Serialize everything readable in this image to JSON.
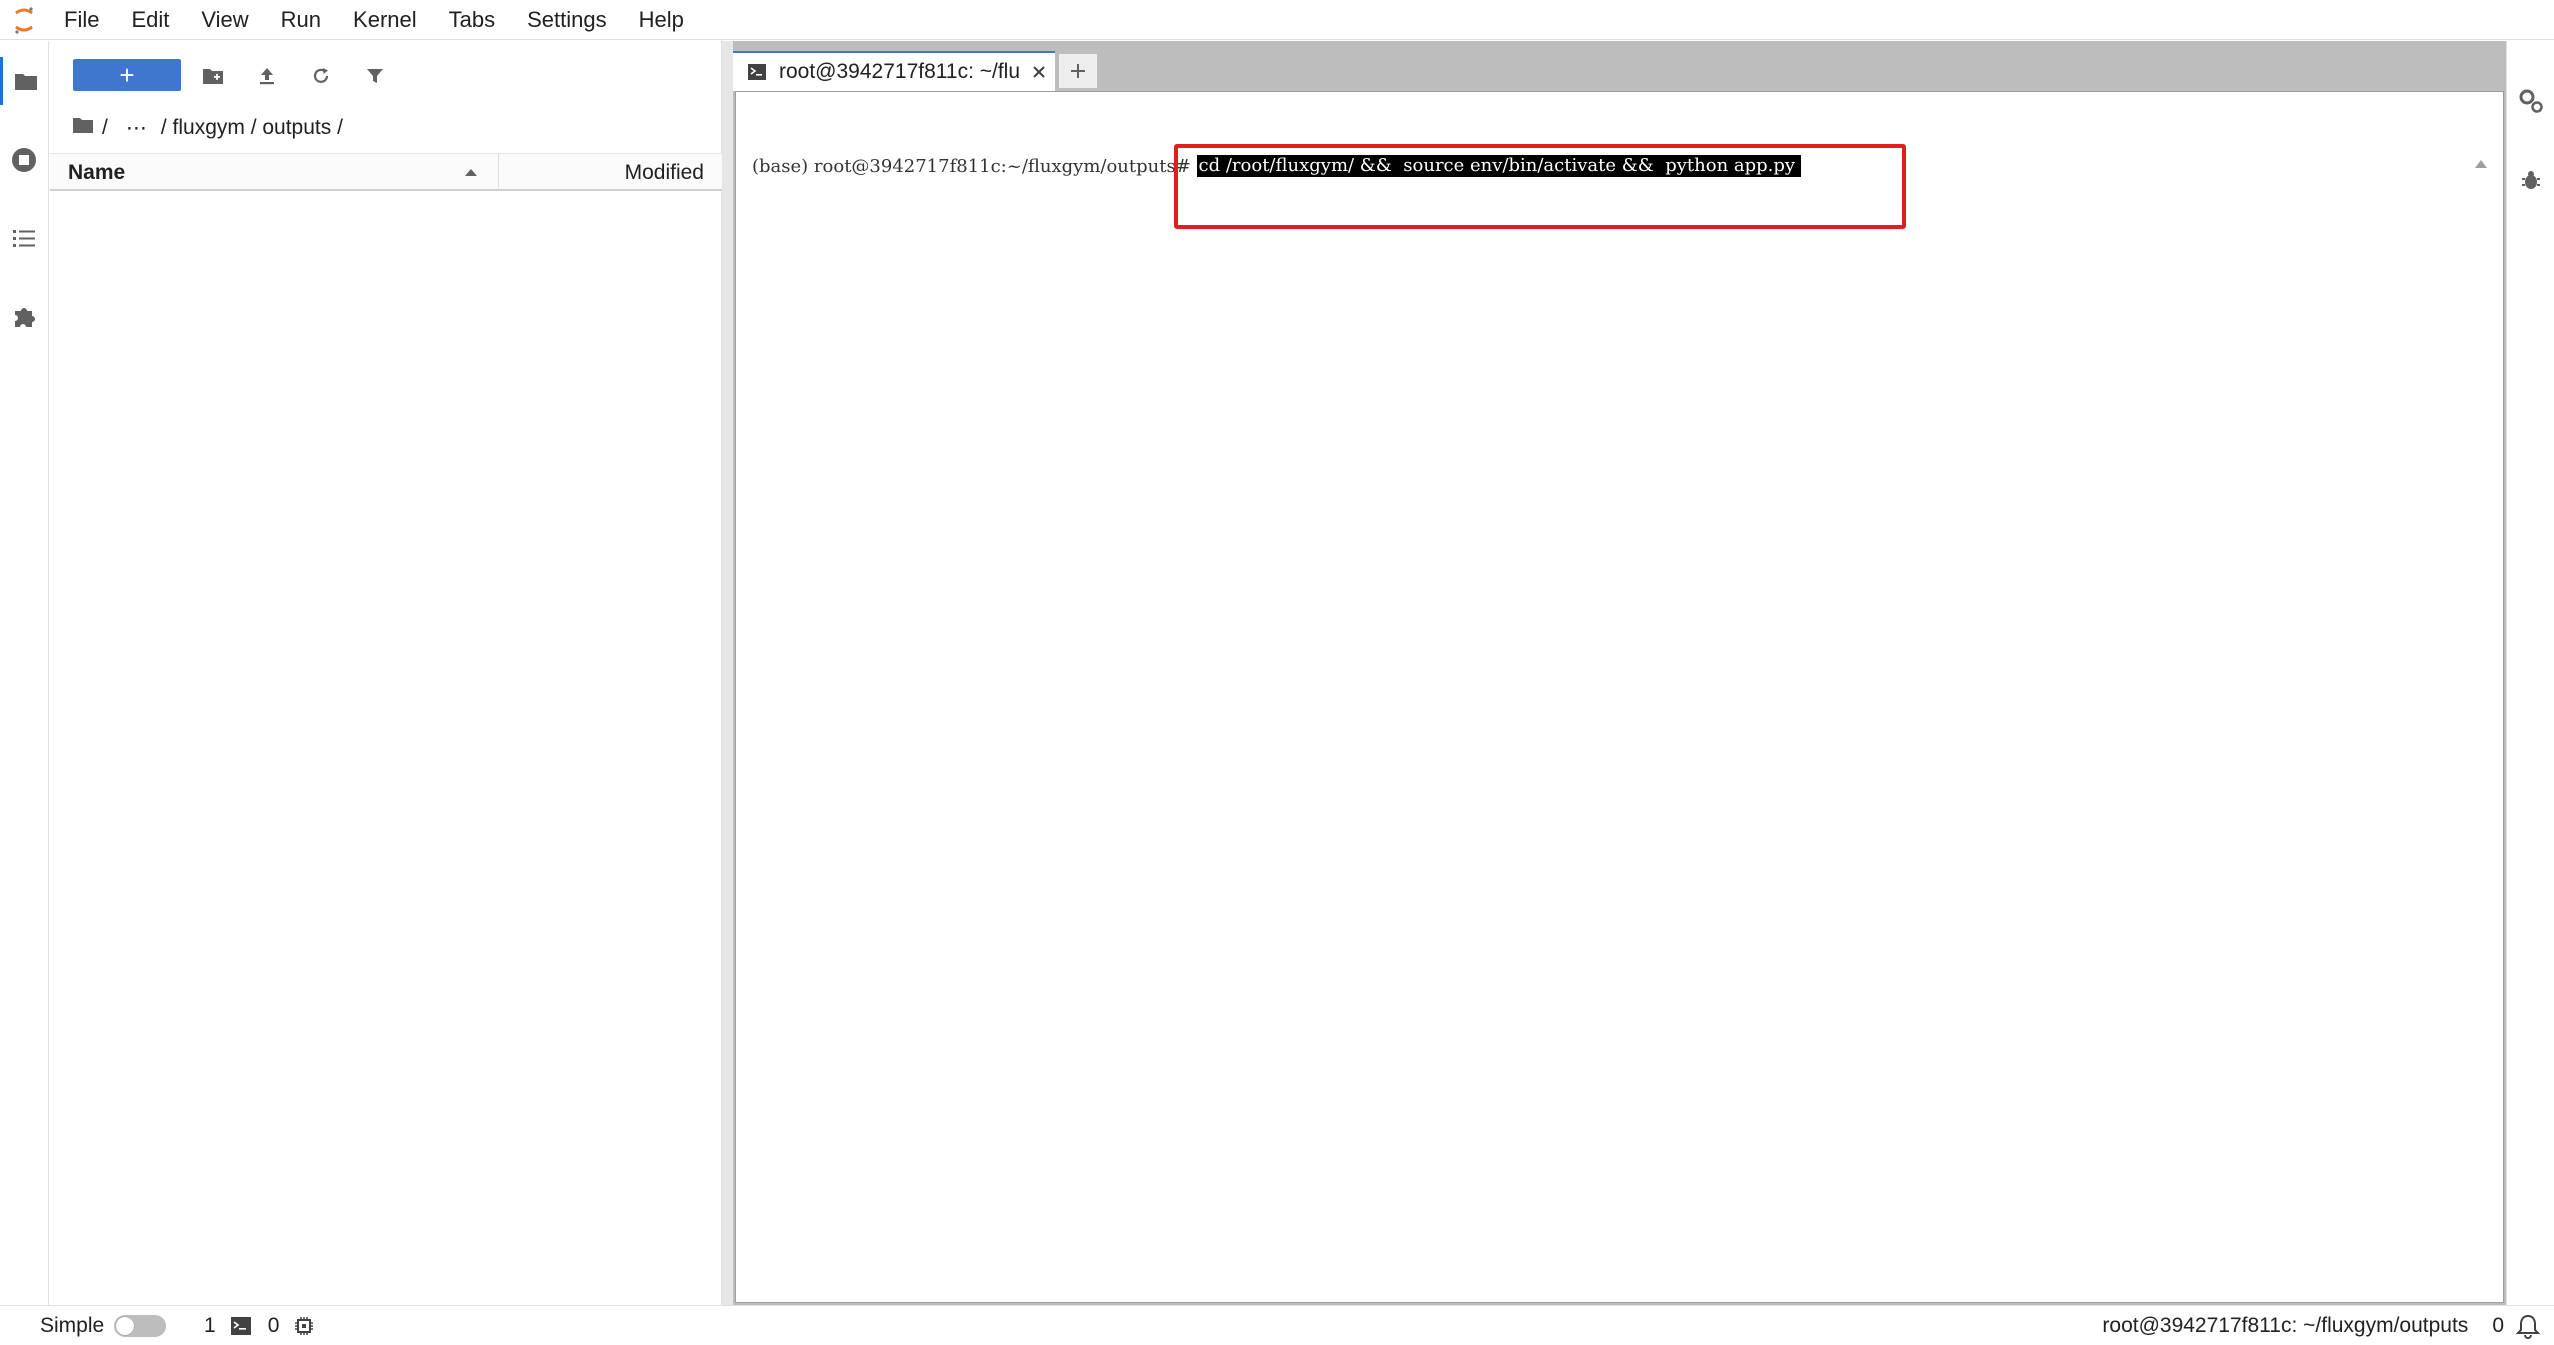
{
  "menubar": {
    "items": [
      "File",
      "Edit",
      "View",
      "Run",
      "Kernel",
      "Tabs",
      "Settings",
      "Help"
    ]
  },
  "left_activity": {
    "icons": [
      "folder-icon",
      "running-sessions-icon",
      "table-of-contents-icon",
      "extension-icon"
    ]
  },
  "filebrowser": {
    "new_button_label": "+",
    "toolbar_icons": [
      "new-folder-icon",
      "upload-icon",
      "refresh-icon",
      "filter-icon"
    ],
    "breadcrumbs": {
      "root": "/",
      "ellipsis": "⋯",
      "path": "/ fluxgym / outputs /"
    },
    "columns": {
      "name": "Name",
      "modified": "Modified"
    },
    "files": []
  },
  "tabs": {
    "terminal_tab_label": "root@3942717f811c: ~/flu",
    "add_tab_label": "+"
  },
  "terminal": {
    "prompt": "(base) root@3942717f811c:~/fluxgym/outputs# ",
    "command": "cd /root/fluxgym/ &&  source env/bin/activate &&  python app.py"
  },
  "right_activity": {
    "icons": [
      "property-inspector-icon",
      "debugger-icon"
    ]
  },
  "statusbar": {
    "mode_label": "Simple",
    "terminals_count": "1",
    "kernels_count": "0",
    "path": "root@3942717f811c: ~/fluxgym/outputs",
    "notifications_count": "0"
  },
  "colors": {
    "accent": "#3f77cf",
    "highlight_box": "#e01e1e",
    "dock_background": "#bdbdbd"
  }
}
